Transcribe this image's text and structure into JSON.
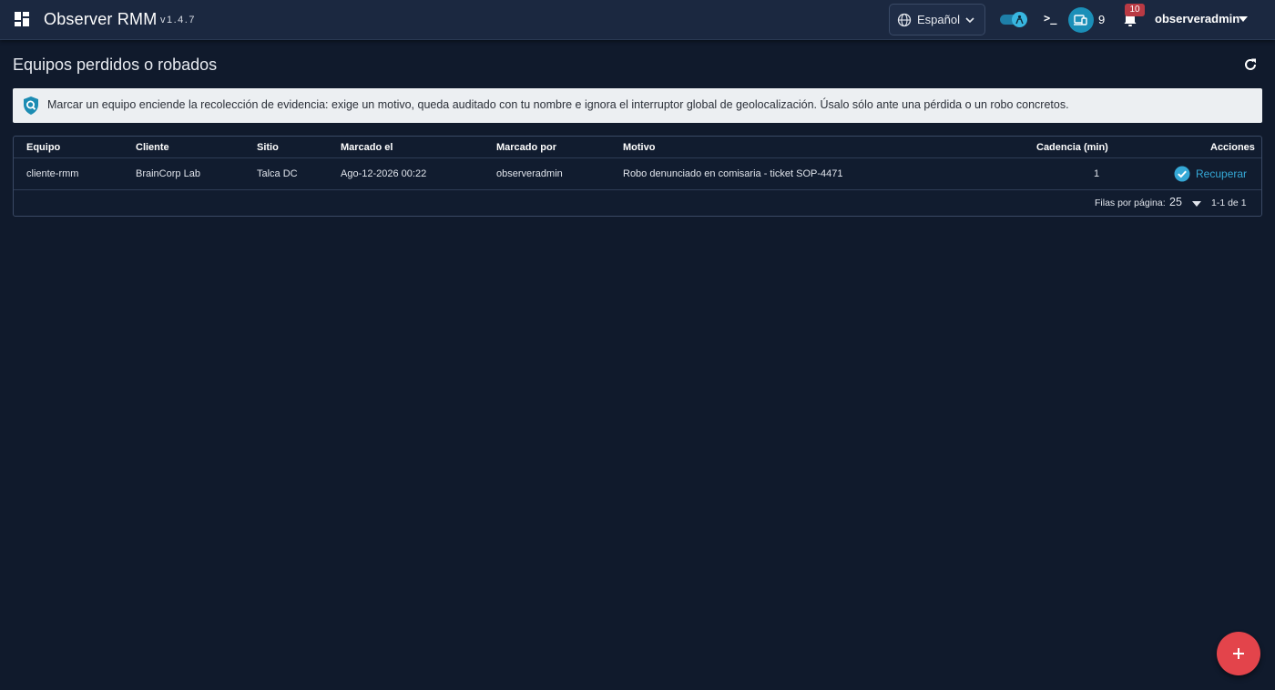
{
  "header": {
    "app_title": "Observer RMM",
    "version": "v1.4.7",
    "language": "Español",
    "terminal_label": ">_",
    "agents_count": "9",
    "notifications_count": "10",
    "username": "observeradmin"
  },
  "page": {
    "title": "Equipos perdidos o robados"
  },
  "banner": {
    "text": "Marcar un equipo enciende la recolección de evidencia: exige un motivo, queda auditado con tu nombre e ignora el interruptor global de geolocalización. Úsalo sólo ante una pérdida o un robo concretos."
  },
  "table": {
    "columns": {
      "equipo": "Equipo",
      "cliente": "Cliente",
      "sitio": "Sitio",
      "marcado_el": "Marcado el",
      "marcado_por": "Marcado por",
      "motivo": "Motivo",
      "cadencia": "Cadencia (min)",
      "acciones": "Acciones"
    },
    "rows": [
      {
        "equipo": "cliente-rmm",
        "cliente": "BrainCorp Lab",
        "sitio": "Talca DC",
        "marcado_el": "Ago-12-2026 00:22",
        "marcado_por": "observeradmin",
        "motivo": "Robo denunciado en comisaria - ticket SOP-4471",
        "cadencia": "1",
        "accion": "Recuperar"
      }
    ],
    "pagination": {
      "rows_per_page_label": "Filas por página:",
      "rows_per_page": "25",
      "range": "1-1 de 1"
    }
  },
  "colors": {
    "background": "#101a2c",
    "topbar": "#1b2840",
    "accent": "#35a8d6",
    "fab": "#e3444b",
    "badge": "#b93a44"
  },
  "icons": {
    "app_menu": "grid-icon",
    "language": "globe-icon",
    "refresh": "refresh-icon",
    "banner": "shield-search-icon",
    "recover": "check-circle-icon",
    "fab": "plus-icon",
    "notifications": "bell-icon",
    "agents": "devices-icon"
  }
}
